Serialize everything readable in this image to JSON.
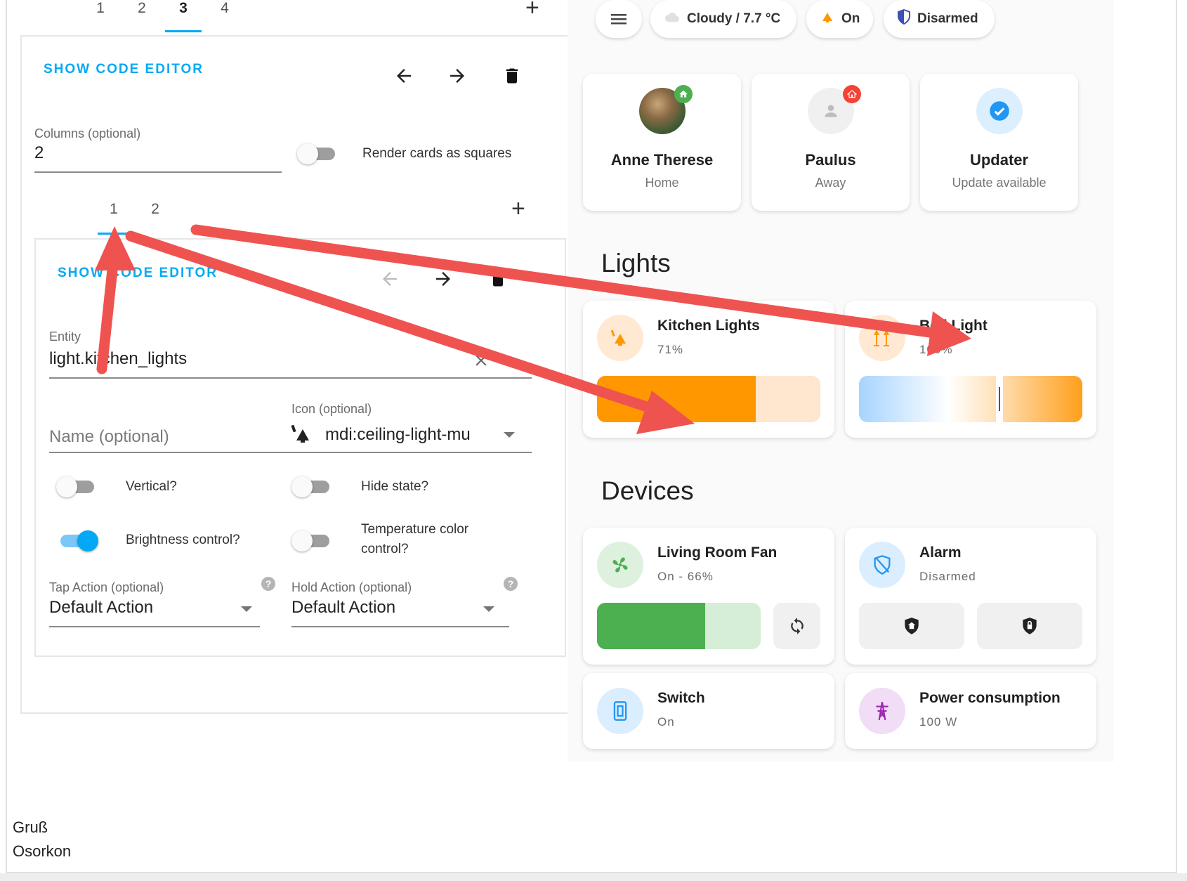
{
  "editor": {
    "top_tabs": [
      "1",
      "2",
      "3",
      "4"
    ],
    "show_code_editor": "SHOW CODE EDITOR",
    "columns_label": "Columns (optional)",
    "columns_value": "2",
    "render_squares_label": "Render cards as squares",
    "inner_tabs": [
      "1",
      "2"
    ],
    "inner": {
      "show_code_editor": "SHOW CODE EDITOR",
      "entity_label": "Entity",
      "entity_value": "light.kitchen_lights",
      "name_placeholder": "Name (optional)",
      "icon_label": "Icon (optional)",
      "icon_value": "mdi:ceiling-light-mu",
      "vertical_label": "Vertical?",
      "hide_state_label": "Hide state?",
      "brightness_label": "Brightness control?",
      "temp_color_label_1": "Temperature color",
      "temp_color_label_2": "control?",
      "tap_action_label": "Tap Action (optional)",
      "tap_action_value": "Default Action",
      "hold_action_label": "Hold Action (optional)",
      "hold_action_value": "Default Action",
      "help_glyph": "?"
    }
  },
  "dashboard": {
    "chips": {
      "weather": "Cloudy / 7.7 °C",
      "light": "On",
      "alarm": "Disarmed"
    },
    "persons": [
      {
        "name": "Anne Therese",
        "state": "Home"
      },
      {
        "name": "Paulus",
        "state": "Away"
      },
      {
        "name": "Updater",
        "state": "Update available"
      }
    ],
    "lights_title": "Lights",
    "lights": [
      {
        "name": "Kitchen Lights",
        "state": "71%",
        "brightness": 0.71
      },
      {
        "name": "Bed Light",
        "state": "100%",
        "color_temp_position": 0.63
      }
    ],
    "devices_title": "Devices",
    "devices": [
      {
        "name": "Living Room Fan",
        "state": "On - 66%",
        "level": 0.66
      },
      {
        "name": "Alarm",
        "state": "Disarmed"
      },
      {
        "name": "Switch",
        "state": "On"
      },
      {
        "name": "Power consumption",
        "state": "100 W"
      }
    ],
    "colors": {
      "accent": "#03a9f4",
      "light_orange": "#ff9800",
      "fan_green": "#4caf50",
      "annotation_red": "#ef5350"
    }
  },
  "signature": {
    "line1": "Gruß",
    "line2": "Osorkon"
  }
}
